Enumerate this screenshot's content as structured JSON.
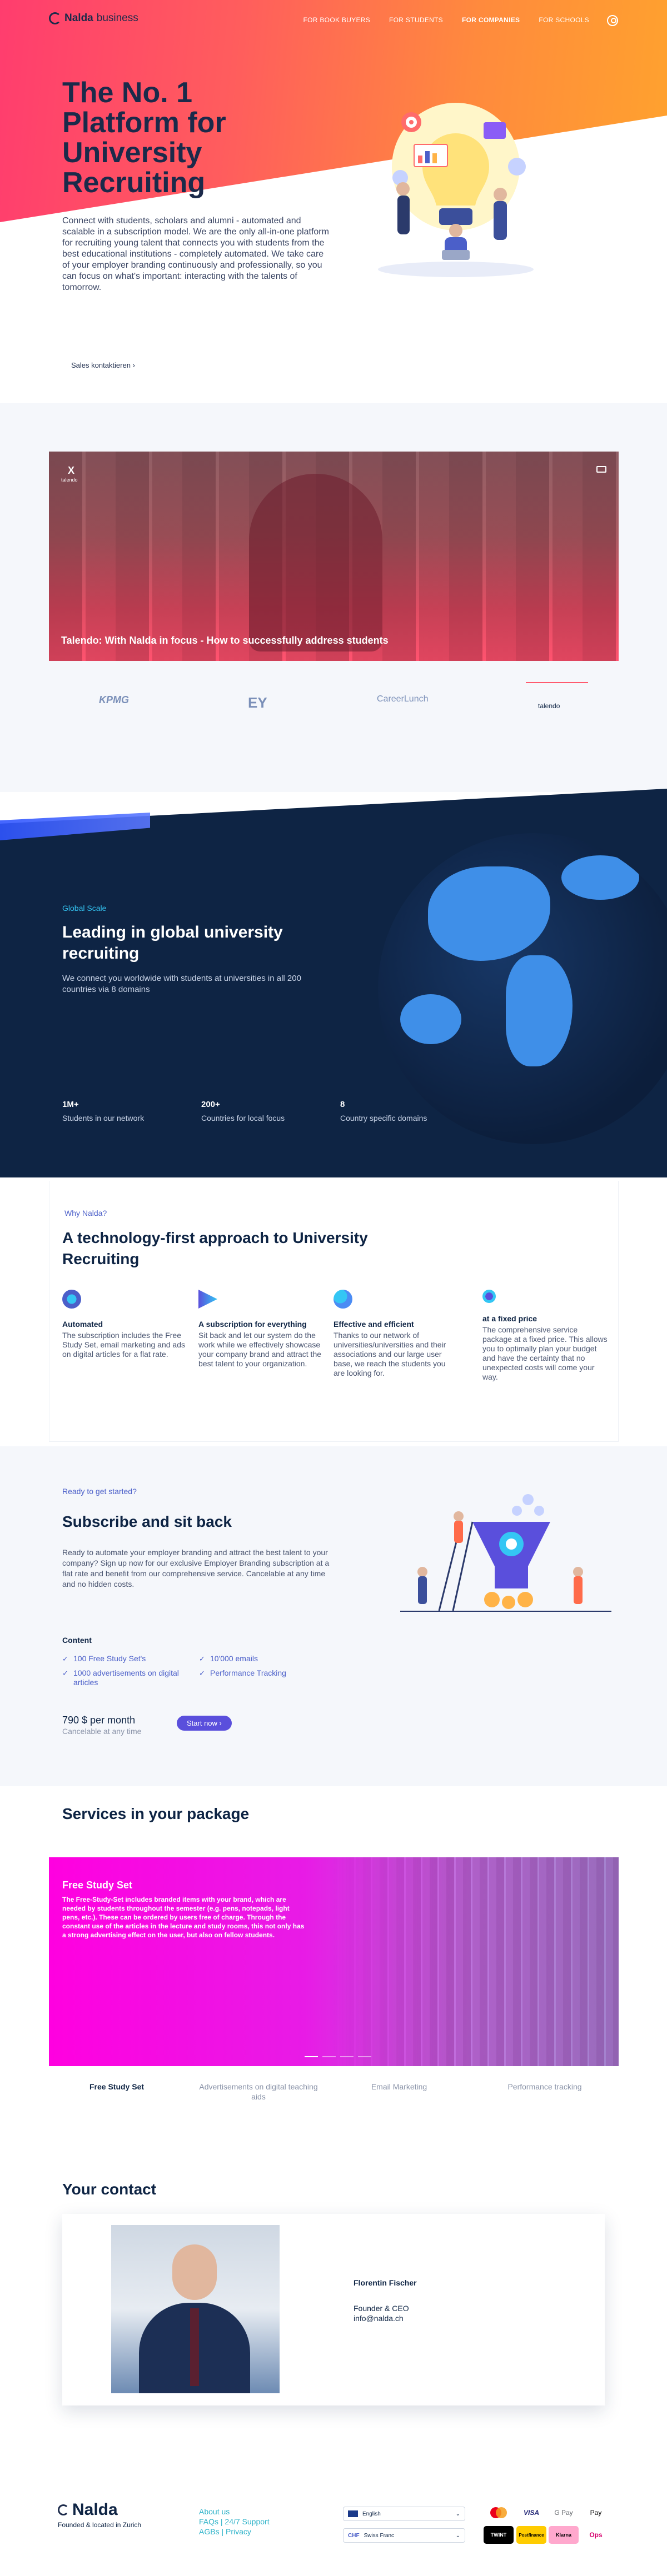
{
  "nav": {
    "logo_bold": "Nalda",
    "logo_thin": "business",
    "links": [
      "FOR BOOK BUYERS",
      "FOR STUDENTS",
      "FOR COMPANIES",
      "FOR SCHOOLS"
    ]
  },
  "hero": {
    "title": "The No. 1 Platform for University Recruiting",
    "text": "Connect with students, scholars and alumni - automated and scalable in a subscription model. We are the only all-in-one platform for recruiting young talent that connects you with students from the best educational institutions - completely automated. We take care of your employer branding continuously and professionally, so you can focus on what's important: interacting with the talents of tomorrow.",
    "cta": "Sales kontaktieren ›"
  },
  "video": {
    "brand": "X",
    "brand_small": "talendo",
    "title": "Talendo: With Nalda in focus - How to successfully address students"
  },
  "partners": [
    "KPMG",
    "EY",
    "CareerLunch",
    "talendo"
  ],
  "global": {
    "kicker": "Global Scale",
    "title": "Leading in global university recruiting",
    "text": "We connect you worldwide with students at universities in all 200 countries via 8 domains",
    "stats": [
      {
        "value": "1M+",
        "label": "Students in our network"
      },
      {
        "value": "200+",
        "label": "Countries for local focus"
      },
      {
        "value": "8",
        "label": "Country specific domains"
      }
    ]
  },
  "why": {
    "kicker": "Why Nalda?",
    "title": "A technology-first approach to University Recruiting",
    "features": [
      {
        "title": "Automated",
        "text": "The subscription includes the Free Study Set, email marketing and ads on digital articles for a flat rate."
      },
      {
        "title": "A subscription for everything",
        "text": "Sit back and let our system do the work while we effectively showcase your company brand and attract the best talent to your organization."
      },
      {
        "title": "Effective and efficient",
        "text": "Thanks to our network of universities/universities and their associations and our large user base, we reach the students you are looking for."
      },
      {
        "title": "at a fixed price",
        "text": "The comprehensive service package at a fixed price. This allows you to optimally plan your budget and have the certainty that no unexpected costs will come your way."
      }
    ]
  },
  "subscribe": {
    "kicker": "Ready to get started?",
    "title": "Subscribe and sit back",
    "text": "Ready to automate your employer branding and attract the best talent to your company? Sign up now for our exclusive Employer Branding subscription at a flat rate and benefit from our comprehensive service. Cancelable at any time and no hidden costs.",
    "content_label": "Content",
    "items": [
      "100 Free Study Set's",
      "10'000 emails",
      "1000 advertisements on digital articles",
      "Performance Tracking"
    ],
    "price": "790 $ per month",
    "price_note": "Cancelable at any time",
    "button": "Start now ›"
  },
  "services": {
    "title": "Services in your package",
    "banner_title": "Free Study Set",
    "banner_text": "The Free-Study-Set includes branded items with your brand, which are needed by students throughout the semester (e.g. pens, notepads, light pens, etc.). These can be ordered by users free of charge. Through the constant use of the articles in the lecture and study rooms, this not only has a strong advertising effect on the user, but also on fellow students.",
    "tabs": [
      "Free Study Set",
      "Advertisements on digital teaching aids",
      "Email Marketing",
      "Performance tracking"
    ]
  },
  "contact": {
    "title": "Your contact",
    "name": "Florentin Fischer",
    "role": "Founder & CEO",
    "email": "info@nalda.ch"
  },
  "footer": {
    "logo": "Nalda",
    "sub": "Founded & located in Zurich",
    "links": [
      "About us",
      "FAQs | 24/7 Support",
      "AGBs | Privacy"
    ],
    "language": "English",
    "currency_code": "CHF",
    "currency": "Swiss Franc",
    "payments": [
      "Mastercard",
      "VISA",
      "G Pay",
      "Pay",
      "Apple Pay",
      "Postfinance",
      "TWINT",
      "Klarna",
      "Ops"
    ]
  }
}
